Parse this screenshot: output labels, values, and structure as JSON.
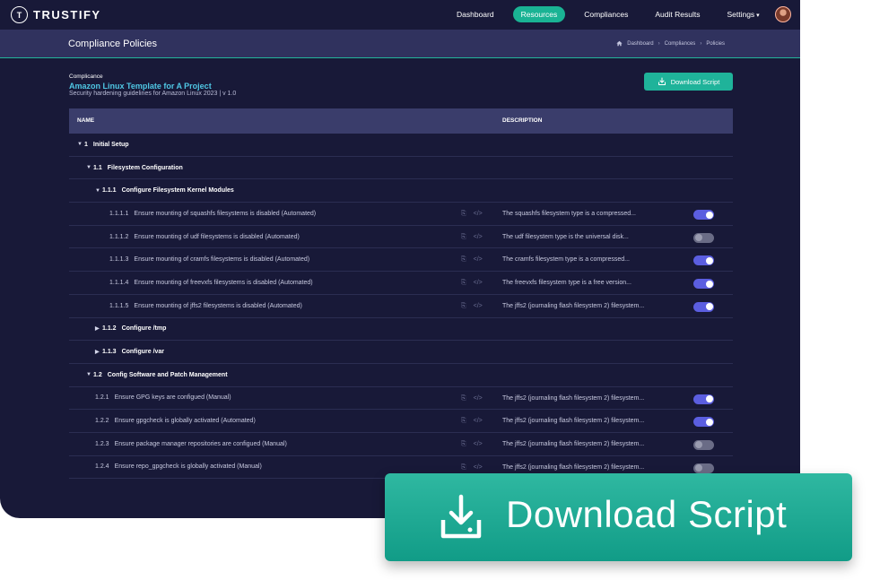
{
  "brand": {
    "name": "TRUSTIFY",
    "mark": "T"
  },
  "nav": {
    "items": [
      {
        "label": "Dashboard",
        "active": false
      },
      {
        "label": "Resources",
        "active": true
      },
      {
        "label": "Compliances",
        "active": false
      },
      {
        "label": "Audit Results",
        "active": false
      },
      {
        "label": "Settings",
        "active": false
      }
    ]
  },
  "page": {
    "title": "Compliance Policies",
    "breadcrumb": [
      "Dashboard",
      "Compliances",
      "Policies"
    ]
  },
  "template": {
    "kicker": "Complicance",
    "name": "Amazon Linux Template for A Project",
    "subtitle": "Security hardening guidelines for Amazon Linux 2023 | v 1.0",
    "download_label": "Download Script"
  },
  "table": {
    "col_name": "NAME",
    "col_desc": "DESCRIPTION",
    "rows": [
      {
        "num": "1",
        "name": "Initial Setup",
        "group": true,
        "indent": 0,
        "caret": "down"
      },
      {
        "num": "1.1",
        "name": "Filesystem Configuration",
        "group": true,
        "indent": 1,
        "caret": "down"
      },
      {
        "num": "1.1.1",
        "name": "Configure Filesystem Kernel Modules",
        "group": true,
        "indent": 2,
        "caret": "down"
      },
      {
        "num": "1.1.1.1",
        "name": "Ensure mounting of squashfs filesystems is disabled (Automated)",
        "desc": "The squashfs filesystem type is a compressed...",
        "enabled": true,
        "indent": 3
      },
      {
        "num": "1.1.1.2",
        "name": "Ensure mounting of udf filesystems is disabled (Automated)",
        "desc": "The udf filesystem type is the universal disk...",
        "enabled": false,
        "indent": 3
      },
      {
        "num": "1.1.1.3",
        "name": "Ensure mounting of cramfs filesystems is disabled (Automated)",
        "desc": "The cramfs filesystem type is a compressed...",
        "enabled": true,
        "indent": 3
      },
      {
        "num": "1.1.1.4",
        "name": "Ensure mounting of freevxfs filesystems is disabled (Automated)",
        "desc": "The freevxfs filesystem type is a free version...",
        "enabled": true,
        "indent": 3
      },
      {
        "num": "1.1.1.5",
        "name": "Ensure mounting of jffs2 filesystems is disabled (Automated)",
        "desc": "The jffs2 (journaling flash filesystem 2) filesystem...",
        "enabled": true,
        "indent": 3
      },
      {
        "num": "1.1.2",
        "name": "Configure /tmp",
        "group": true,
        "indent": 2,
        "caret": "right"
      },
      {
        "num": "1.1.3",
        "name": "Configure /var",
        "group": true,
        "indent": 2,
        "caret": "right"
      },
      {
        "num": "1.2",
        "name": "Config Software and Patch Management",
        "group": true,
        "indent": 1,
        "caret": "down"
      },
      {
        "num": "1.2.1",
        "name": "Ensure GPG keys are configued (Manual)",
        "desc": "The jffs2 (journaling flash filesystem 2) filesystem...",
        "enabled": true,
        "indent": 2
      },
      {
        "num": "1.2.2",
        "name": "Ensure gpgcheck is globally activated (Automated)",
        "desc": "The jffs2 (journaling flash filesystem 2) filesystem...",
        "enabled": true,
        "indent": 2
      },
      {
        "num": "1.2.3",
        "name": "Ensure package manager repositories are configued (Manual)",
        "desc": "The jffs2 (journaling flash filesystem 2) filesystem...",
        "enabled": false,
        "indent": 2
      },
      {
        "num": "1.2.4",
        "name": "Ensure repo_gpgcheck is globally activated (Manual)",
        "desc": "The jffs2 (journaling flash filesystem 2) filesystem...",
        "enabled": false,
        "indent": 2
      }
    ]
  },
  "cta": {
    "label": "Download Script"
  },
  "colors": {
    "accent": "#1ab394",
    "background": "#181938",
    "toggle_on": "#5b5ee0",
    "link": "#4fc7e4"
  }
}
